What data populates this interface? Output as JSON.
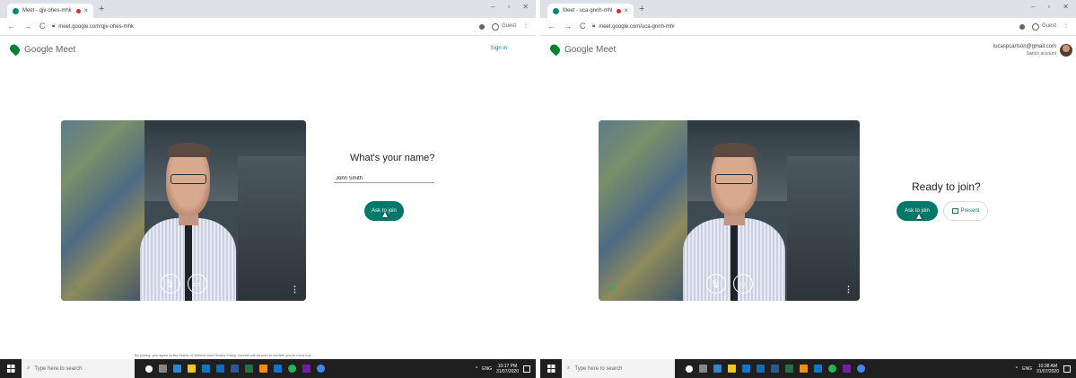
{
  "left": {
    "tab_title": "Meet - qjv-ohes-mhk",
    "url": "meet.google.com/qjv-ohes-mhk",
    "guest_label": "Guest",
    "brand": "Google Meet",
    "sign_in": "Sign in",
    "prompt": "What's your name?",
    "name_value": "John Smith",
    "ask_to_join": "Ask to join",
    "terms": "By joining, you agree to the Terms of Service and Privacy Policy. Guests will be sent to confirm you're not a bot.",
    "time": "10:17 PM",
    "date": "31/07/2020"
  },
  "right": {
    "tab_title": "Meet - uca-gnnh-mhl",
    "url": "meet.google.com/uca-gnnh-mhl",
    "guest_label": "Guest",
    "brand": "Google Meet",
    "account_email": "lucaspcarlson@gmail.com",
    "switch_account": "Switch account",
    "prompt": "Ready to join?",
    "ask_to_join": "Ask to join",
    "present": "Present",
    "time": "10:38 AM",
    "date": "31/07/2020"
  },
  "taskbar": {
    "search_placeholder": "Type here to search",
    "language": "ENG"
  },
  "colors": {
    "meet_teal": "#00796b",
    "meet_green": "#00832d",
    "link_blue": "#1a73e8"
  }
}
